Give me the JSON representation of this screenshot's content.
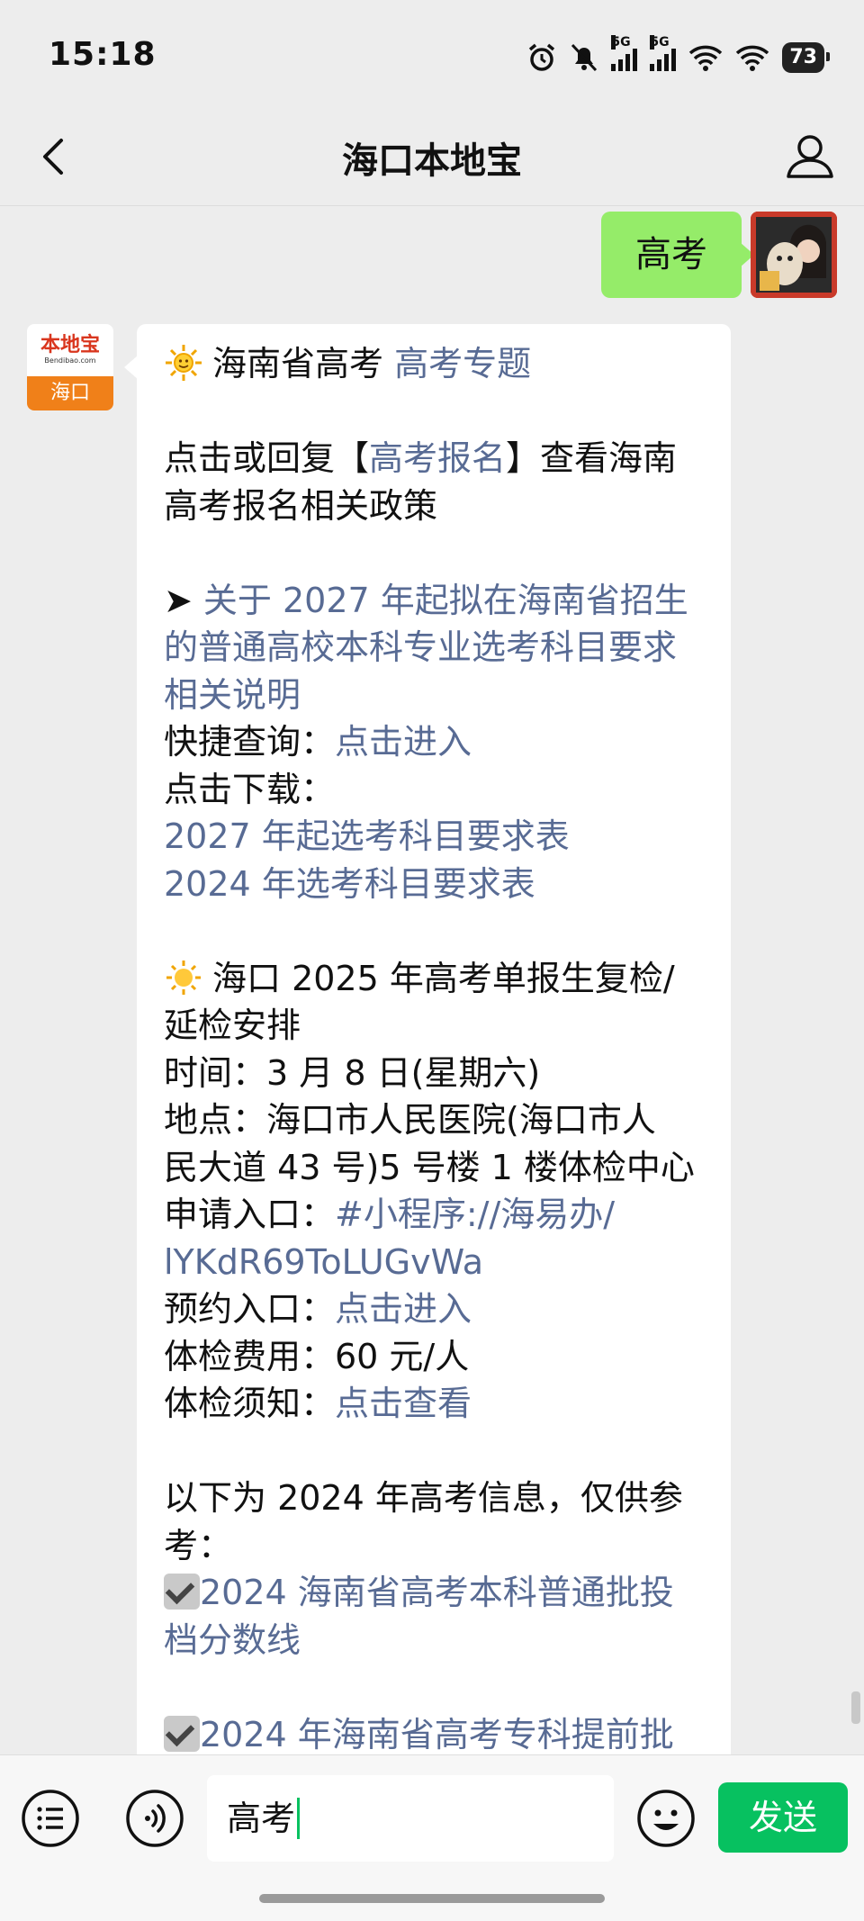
{
  "status_bar": {
    "time": "15:18",
    "battery": "73"
  },
  "nav": {
    "title": "海口本地宝"
  },
  "chat": {
    "user_message": "高考",
    "bot_avatar": {
      "logo_text": "本地宝",
      "logo_sub": "Bendibao.com",
      "city": "海口"
    },
    "reply": {
      "l1_text": "海南省高考 ",
      "l1_link": "高考专题",
      "l2_pre": "点击或回复【",
      "l2_link": "高考报名",
      "l2_post": "】查看海南",
      "l3": "高考报名相关政策",
      "l4_arrow": "➤ ",
      "l4_link": "关于 2027 年起拟在海南省招生",
      "l5_link": "的普通高校本科专业选考科目要求",
      "l6_link": "相关说明",
      "l7_label": "快捷查询：",
      "l7_link": "点击进入",
      "l8": "点击下载：",
      "l9_link": "2027 年起选考科目要求表",
      "l10_link": "2024 年选考科目要求表",
      "l11": "海口 2025 年高考单报生复检/",
      "l12": "延检安排",
      "l13": "时间：3 月 8 日(星期六)",
      "l14": "地点：海口市人民医院(海口市人",
      "l15": "民大道 43 号)5 号楼 1 楼体检中心",
      "l16_label": "申请入口：",
      "l16_link": "#小程序://海易办/",
      "l17_link": "lYKdR69ToLUGvWa",
      "l18_label": "预约入口：",
      "l18_link": "点击进入",
      "l19": "体检费用：60 元/人",
      "l20_label": "体检须知：",
      "l20_link": "点击查看",
      "l21": "以下为 2024 年高考信息，仅供参",
      "l22": "考：",
      "l23_link": "2024 海南省高考本科普通批投",
      "l24_link": "档分数线",
      "l25_link": "2024 年海南省高考专科提前批"
    }
  },
  "input_bar": {
    "input_value": "高考",
    "send_label": "发送"
  },
  "colors": {
    "link": "#586b94",
    "user_bubble": "#95ec69",
    "send_button": "#07c160"
  }
}
